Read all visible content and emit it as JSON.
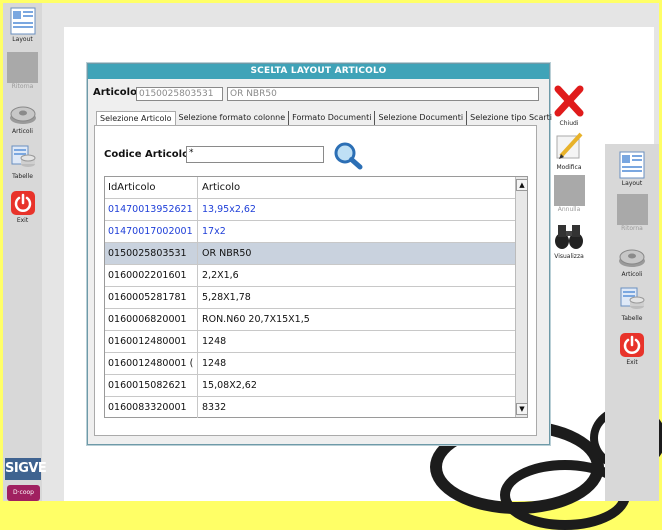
{
  "sidebar_left": {
    "items": [
      {
        "label": "Layout",
        "icon": "layout-icon",
        "enabled": true
      },
      {
        "label": "Ritorna",
        "icon": "back-icon",
        "enabled": false
      },
      {
        "label": "Articoli",
        "icon": "gear-icon",
        "enabled": true
      },
      {
        "label": "Tabelle",
        "icon": "table-icon",
        "enabled": true
      },
      {
        "label": "Exit",
        "icon": "power-icon",
        "enabled": true
      }
    ],
    "logo": "SIGVE",
    "logo2": "D·coop"
  },
  "sidebar_right": {
    "items": [
      {
        "label": "Layout",
        "icon": "layout-icon",
        "enabled": true
      },
      {
        "label": "Ritorna",
        "icon": "back-icon",
        "enabled": false
      },
      {
        "label": "Articoli",
        "icon": "gear-icon",
        "enabled": true
      },
      {
        "label": "Tabelle",
        "icon": "table-icon",
        "enabled": true
      },
      {
        "label": "Exit",
        "icon": "power-icon",
        "enabled": true
      }
    ]
  },
  "dialog": {
    "title": "SCELTA LAYOUT ARTICOLO",
    "articolo_label": "Articolo",
    "articolo_code": "0150025803531",
    "articolo_desc": "OR NBR50",
    "tabs": [
      "Selezione Articolo",
      "Selezione formato colonne",
      "Formato Documenti",
      "Selezione Documenti",
      "Selezione tipo Scarti"
    ],
    "search": {
      "label": "Codice Articolo",
      "value": "*"
    },
    "table": {
      "headers": [
        "IdArticolo",
        "Articolo"
      ],
      "rows": [
        {
          "id": "01470013952621",
          "desc": "13,95x2,62",
          "style": "blue"
        },
        {
          "id": "01470017002001",
          "desc": "17x2",
          "style": "blue"
        },
        {
          "id": "0150025803531",
          "desc": "OR NBR50",
          "style": "selected"
        },
        {
          "id": "0160002201601",
          "desc": "2,2X1,6",
          "style": "normal"
        },
        {
          "id": "0160005281781",
          "desc": "5,28X1,78",
          "style": "normal"
        },
        {
          "id": "0160006820001",
          "desc": "RON.N60 20,7X15X1,5",
          "style": "normal"
        },
        {
          "id": "0160012480001",
          "desc": "1248",
          "style": "normal"
        },
        {
          "id": "0160012480001 (",
          "desc": "1248",
          "style": "normal"
        },
        {
          "id": "0160015082621",
          "desc": "15,08X2,62",
          "style": "normal"
        },
        {
          "id": "0160083320001",
          "desc": "8332",
          "style": "normal"
        }
      ]
    },
    "buttons": {
      "chiudi": "Chiudi",
      "modifica": "Modifica",
      "annulla": "Annulla",
      "visualizza": "Visualizza"
    }
  },
  "colors": {
    "title_bar": "#3fa3b8",
    "blue_text": "#1f3fd8",
    "selected_row": "#c9d2de",
    "exit_red": "#e8332a",
    "background": "#ffff66"
  }
}
